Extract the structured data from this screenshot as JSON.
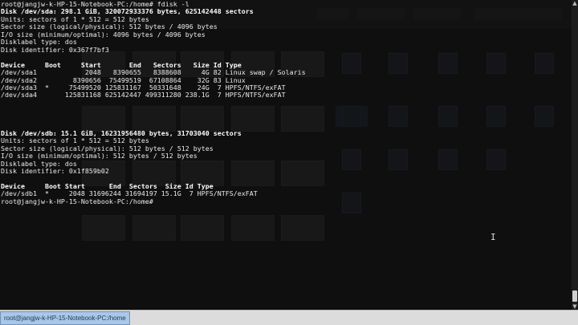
{
  "terminal": {
    "lines": [
      {
        "text": "root@jangjw-k-HP-15-Notebook-PC:/home# fdisk -l",
        "bold": false
      },
      {
        "text": "Disk /dev/sda: 298.1 GiB, 320072933376 bytes, 625142448 sectors",
        "bold": true
      },
      {
        "text": "Units: sectors of 1 * 512 = 512 bytes",
        "bold": false
      },
      {
        "text": "Sector size (logical/physical): 512 bytes / 4096 bytes",
        "bold": false
      },
      {
        "text": "I/O size (minimum/optimal): 4096 bytes / 4096 bytes",
        "bold": false
      },
      {
        "text": "Disklabel type: dos",
        "bold": false
      },
      {
        "text": "Disk identifier: 0x367f7bf3",
        "bold": false
      },
      {
        "text": "",
        "bold": false
      },
      {
        "text": "Device     Boot     Start       End   Sectors   Size Id Type",
        "bold": true
      },
      {
        "text": "/dev/sda1            2048   8390655   8388608     4G 82 Linux swap / Solaris",
        "bold": false
      },
      {
        "text": "/dev/sda2         8390656  75499519  67108864    32G 83 Linux",
        "bold": false
      },
      {
        "text": "/dev/sda3  *     75499520 125831167  50331648    24G  7 HPFS/NTFS/exFAT",
        "bold": false
      },
      {
        "text": "/dev/sda4       125831168 625142447 499311280 238.1G  7 HPFS/NTFS/exFAT",
        "bold": false
      },
      {
        "text": "",
        "bold": false
      },
      {
        "text": "",
        "bold": false
      },
      {
        "text": "",
        "bold": false
      },
      {
        "text": "",
        "bold": false
      },
      {
        "text": "Disk /dev/sdb: 15.1 GiB, 16231956480 bytes, 31703040 sectors",
        "bold": true
      },
      {
        "text": "Units: sectors of 1 * 512 = 512 bytes",
        "bold": false
      },
      {
        "text": "Sector size (logical/physical): 512 bytes / 512 bytes",
        "bold": false
      },
      {
        "text": "I/O size (minimum/optimal): 512 bytes / 512 bytes",
        "bold": false
      },
      {
        "text": "Disklabel type: dos",
        "bold": false
      },
      {
        "text": "Disk identifier: 0x1f859b02",
        "bold": false
      },
      {
        "text": "",
        "bold": false
      },
      {
        "text": "Device     Boot Start      End  Sectors  Size Id Type",
        "bold": true
      },
      {
        "text": "/dev/sdb1  *     2048 31696244 31694197 15.1G  7 HPFS/NTFS/exFAT",
        "bold": false
      },
      {
        "text": "root@jangjw-k-HP-15-Notebook-PC:/home# ",
        "bold": false
      }
    ]
  },
  "taskbar": {
    "active_task": "root@jangjw-k-HP-15-Notebook-PC:/home"
  },
  "scrollbar": {
    "up_icon": "arrow-up-icon",
    "down_icon": "arrow-down-icon"
  },
  "cursor": {
    "icon": "text-cursor-icon",
    "glyph": "I"
  }
}
